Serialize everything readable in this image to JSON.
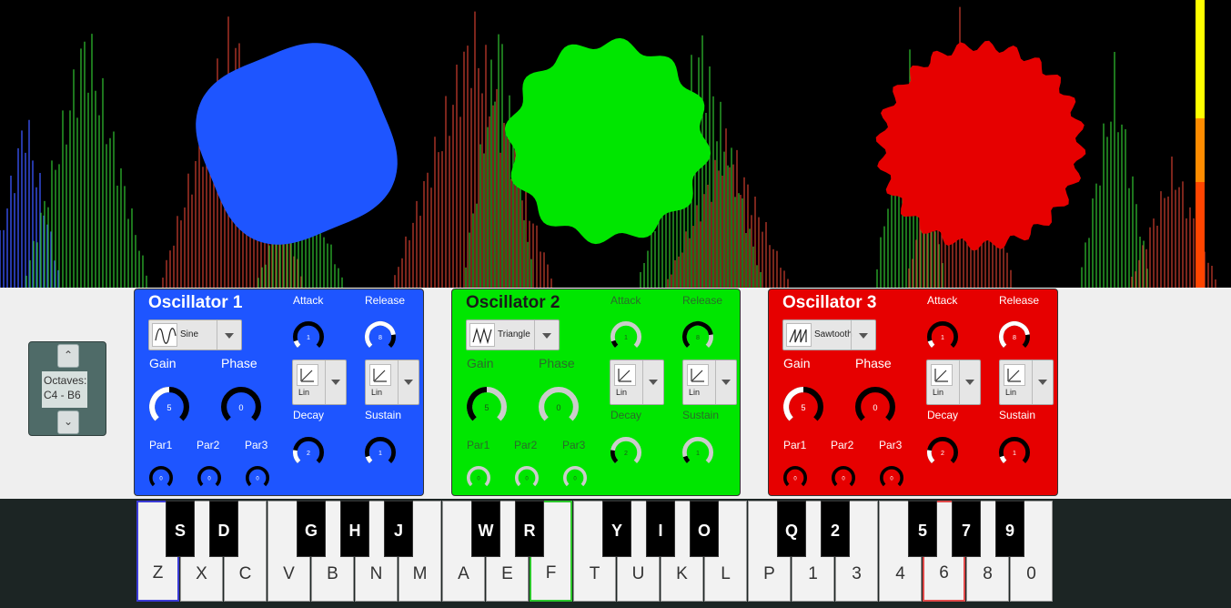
{
  "octaves": {
    "label_line1": "Octaves:",
    "label_line2": "C4 - B6"
  },
  "oscillators": [
    {
      "title": "Oscillator 1",
      "color": "#1e55ff",
      "knob_bg": "#000000",
      "knob_fill": "#1e55ff",
      "arc_color": "#ffffff",
      "track_color": "#000000",
      "waveform": "Sine",
      "labels": {
        "gain": "Gain",
        "phase": "Phase",
        "attack": "Attack",
        "release": "Release",
        "decay": "Decay",
        "sustain": "Sustain",
        "par1": "Par1",
        "par2": "Par2",
        "par3": "Par3"
      },
      "values": {
        "gain": "5",
        "phase": "0",
        "attack": "1",
        "release": "8",
        "decay": "2",
        "sustain": "1",
        "par1": "0",
        "par2": "0",
        "par3": "0"
      },
      "attack_curve": "Lin",
      "release_curve": "Lin"
    },
    {
      "title": "Oscillator 2",
      "color": "#00e600",
      "knob_bg": "#cccccc",
      "knob_fill": "#00e600",
      "arc_color": "#000000",
      "track_color": "#cccccc",
      "waveform": "Triangle",
      "labels": {
        "gain": "Gain",
        "phase": "Phase",
        "attack": "Attack",
        "release": "Release",
        "decay": "Decay",
        "sustain": "Sustain",
        "par1": "Par1",
        "par2": "Par2",
        "par3": "Par3"
      },
      "values": {
        "gain": "5",
        "phase": "0",
        "attack": "1",
        "release": "8",
        "decay": "2",
        "sustain": "1",
        "par1": "0",
        "par2": "0",
        "par3": "0"
      },
      "attack_curve": "Lin",
      "release_curve": "Lin"
    },
    {
      "title": "Oscillator 3",
      "color": "#e60000",
      "knob_bg": "#000000",
      "knob_fill": "#e60000",
      "arc_color": "#ffffff",
      "track_color": "#000000",
      "waveform": "Sawtooth",
      "labels": {
        "gain": "Gain",
        "phase": "Phase",
        "attack": "Attack",
        "release": "Release",
        "decay": "Decay",
        "sustain": "Sustain",
        "par1": "Par1",
        "par2": "Par2",
        "par3": "Par3"
      },
      "values": {
        "gain": "5",
        "phase": "0",
        "attack": "1",
        "release": "8",
        "decay": "2",
        "sustain": "1",
        "par1": "0",
        "par2": "0",
        "par3": "0"
      },
      "attack_curve": "Lin",
      "release_curve": "Lin"
    }
  ],
  "keyboard": {
    "white_keys": [
      "Z",
      "X",
      "C",
      "V",
      "B",
      "N",
      "M",
      "A",
      "E",
      "F",
      "T",
      "U",
      "K",
      "L",
      "P",
      "1",
      "3",
      "4",
      "6",
      "8",
      "0"
    ],
    "black_keys": [
      "S",
      "D",
      "G",
      "H",
      "J",
      "W",
      "R",
      "Y",
      "I",
      "O",
      "Q",
      "2",
      "5",
      "7",
      "9"
    ]
  }
}
